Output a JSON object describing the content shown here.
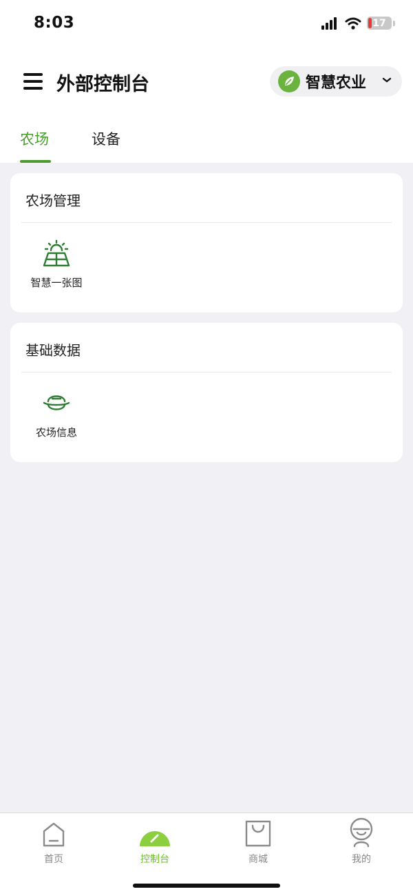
{
  "status_bar": {
    "time": "8:03",
    "battery": "17"
  },
  "header": {
    "title": "外部控制台",
    "org_name": "智慧农业"
  },
  "tabs": [
    {
      "label": "农场",
      "active": true
    },
    {
      "label": "设备",
      "active": false
    }
  ],
  "sections": [
    {
      "title": "农场管理",
      "items": [
        {
          "label": "智慧一张图",
          "icon": "solar-panel-icon"
        }
      ]
    },
    {
      "title": "基础数据",
      "items": [
        {
          "label": "农场信息",
          "icon": "farmer-hat-icon"
        }
      ]
    }
  ],
  "bottom_nav": [
    {
      "label": "首页",
      "icon": "home-icon",
      "active": false
    },
    {
      "label": "控制台",
      "icon": "dashboard-gauge-icon",
      "active": true
    },
    {
      "label": "商城",
      "icon": "shopping-bag-icon",
      "active": false
    },
    {
      "label": "我的",
      "icon": "user-icon",
      "active": false
    }
  ],
  "colors": {
    "accent": "#4a9b2e",
    "nav_active": "#6cbf2b",
    "background": "#f0f0f5"
  }
}
